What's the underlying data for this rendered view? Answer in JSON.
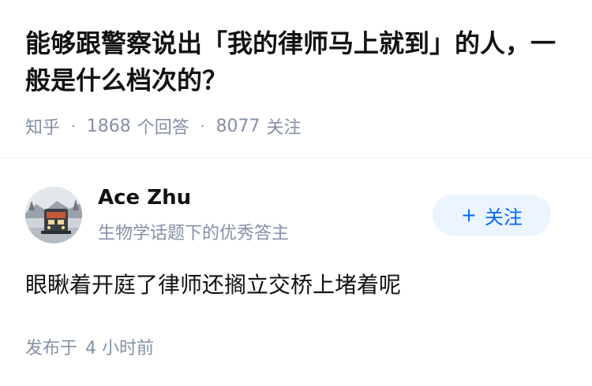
{
  "question": {
    "title": "能够跟警察说出「我的律师马上就到」的人，一般是什么档次的？",
    "source": "知乎",
    "answer_count": "1868",
    "answer_label": "个回答",
    "follow_count": "8077",
    "follow_label": "关注"
  },
  "answer": {
    "author_name": "Ace Zhu",
    "author_badge": "生物学话题下的优秀答主",
    "follow_button_label": "关注",
    "follow_button_icon": "plus-icon",
    "content": "眼瞅着开庭了律师还搁立交桥上堵着呢",
    "publish_prefix": "发布于",
    "publish_time": "4 小时前"
  },
  "colors": {
    "meta_gray": "#8590a6",
    "accent_blue": "#0066ff",
    "follow_bg": "#ebf5ff",
    "text": "#121212"
  }
}
